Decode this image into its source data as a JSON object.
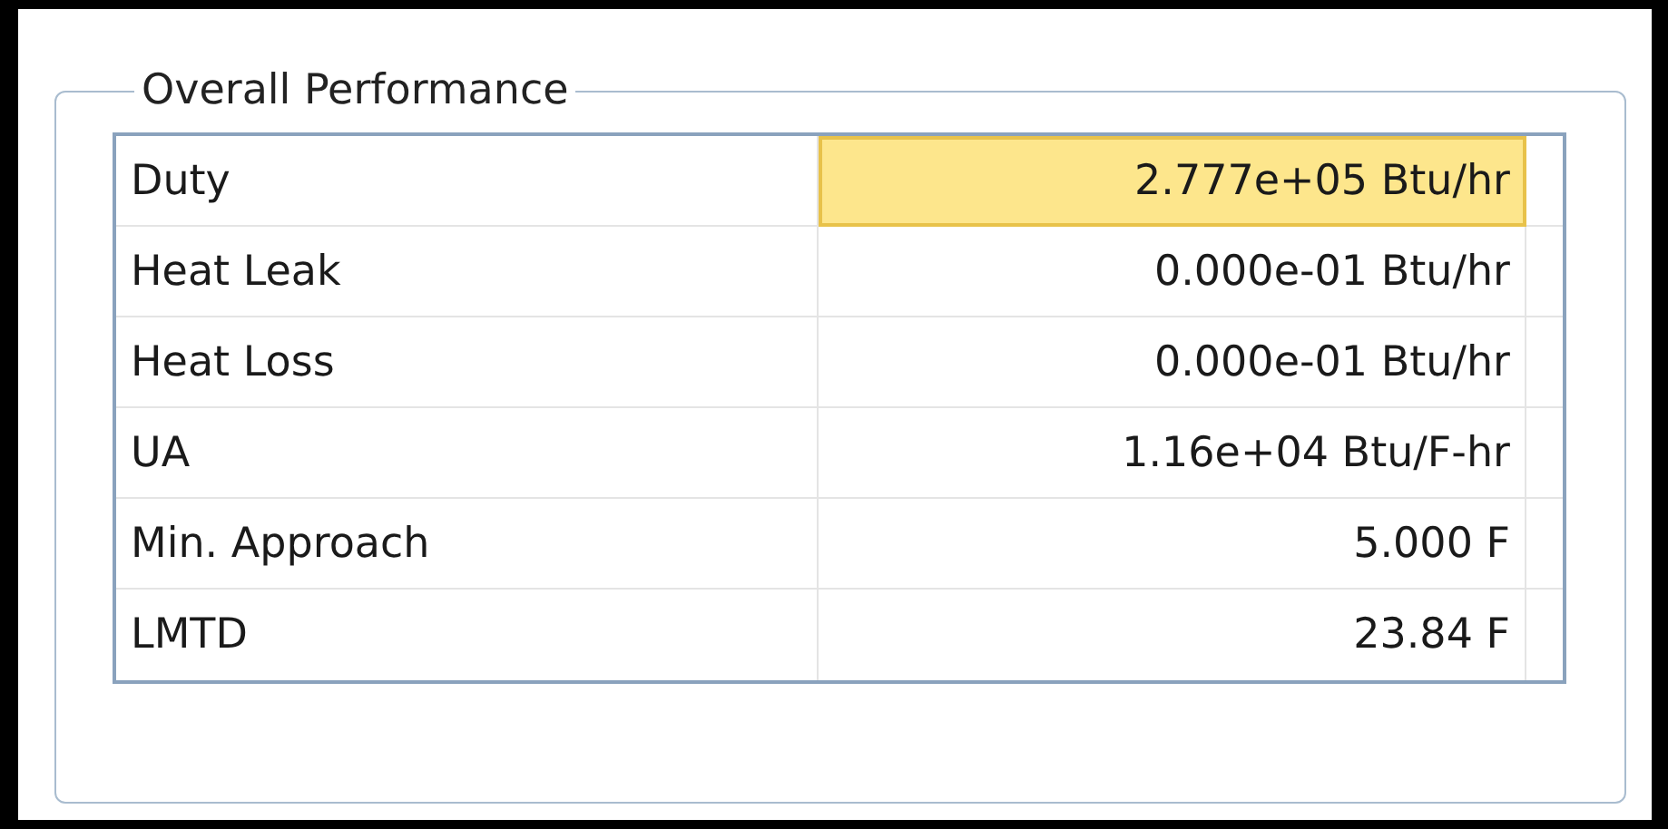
{
  "group": {
    "title": "Overall Performance"
  },
  "rows": [
    {
      "label": "Duty",
      "value": "2.777e+05 Btu/hr",
      "selected": true
    },
    {
      "label": "Heat Leak",
      "value": "0.000e-01 Btu/hr",
      "selected": false
    },
    {
      "label": "Heat Loss",
      "value": "0.000e-01 Btu/hr",
      "selected": false
    },
    {
      "label": "UA",
      "value": "1.16e+04 Btu/F-hr",
      "selected": false
    },
    {
      "label": "Min. Approach",
      "value": "5.000 F",
      "selected": false
    },
    {
      "label": "LMTD",
      "value": "23.84 F",
      "selected": false
    }
  ]
}
